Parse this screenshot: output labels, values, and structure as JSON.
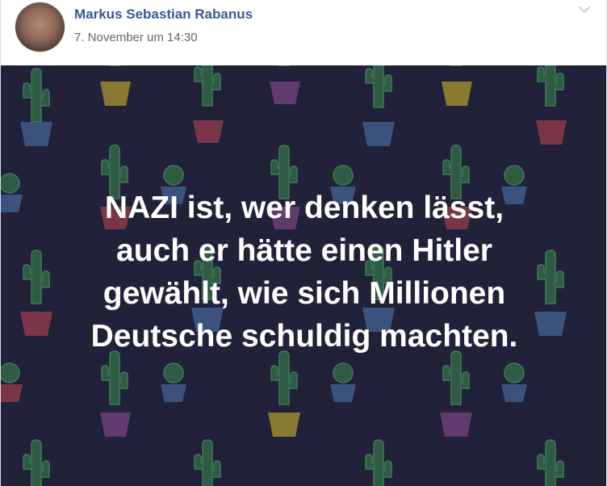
{
  "post": {
    "author": "Markus Sebastian Rabanus",
    "timestamp": "7. November um 14:30",
    "menu_icon": "chevron-down-icon"
  },
  "image": {
    "background_color": "#22213a",
    "pattern": "cactus-pattern",
    "text_lines": [
      "NAZI ist, wer denken lässt,",
      "auch er hätte einen Hitler",
      "gewählt, wie sich Millionen",
      "Deutsche schuldig machten."
    ]
  },
  "colors": {
    "link": "#385898",
    "meta": "#606770",
    "cactus": "#2f5a44",
    "pot_blue": "#3f5a8c",
    "pot_red": "#8a3a4a",
    "pot_yellow": "#9a8a30",
    "pot_purple": "#6a3f7a"
  }
}
